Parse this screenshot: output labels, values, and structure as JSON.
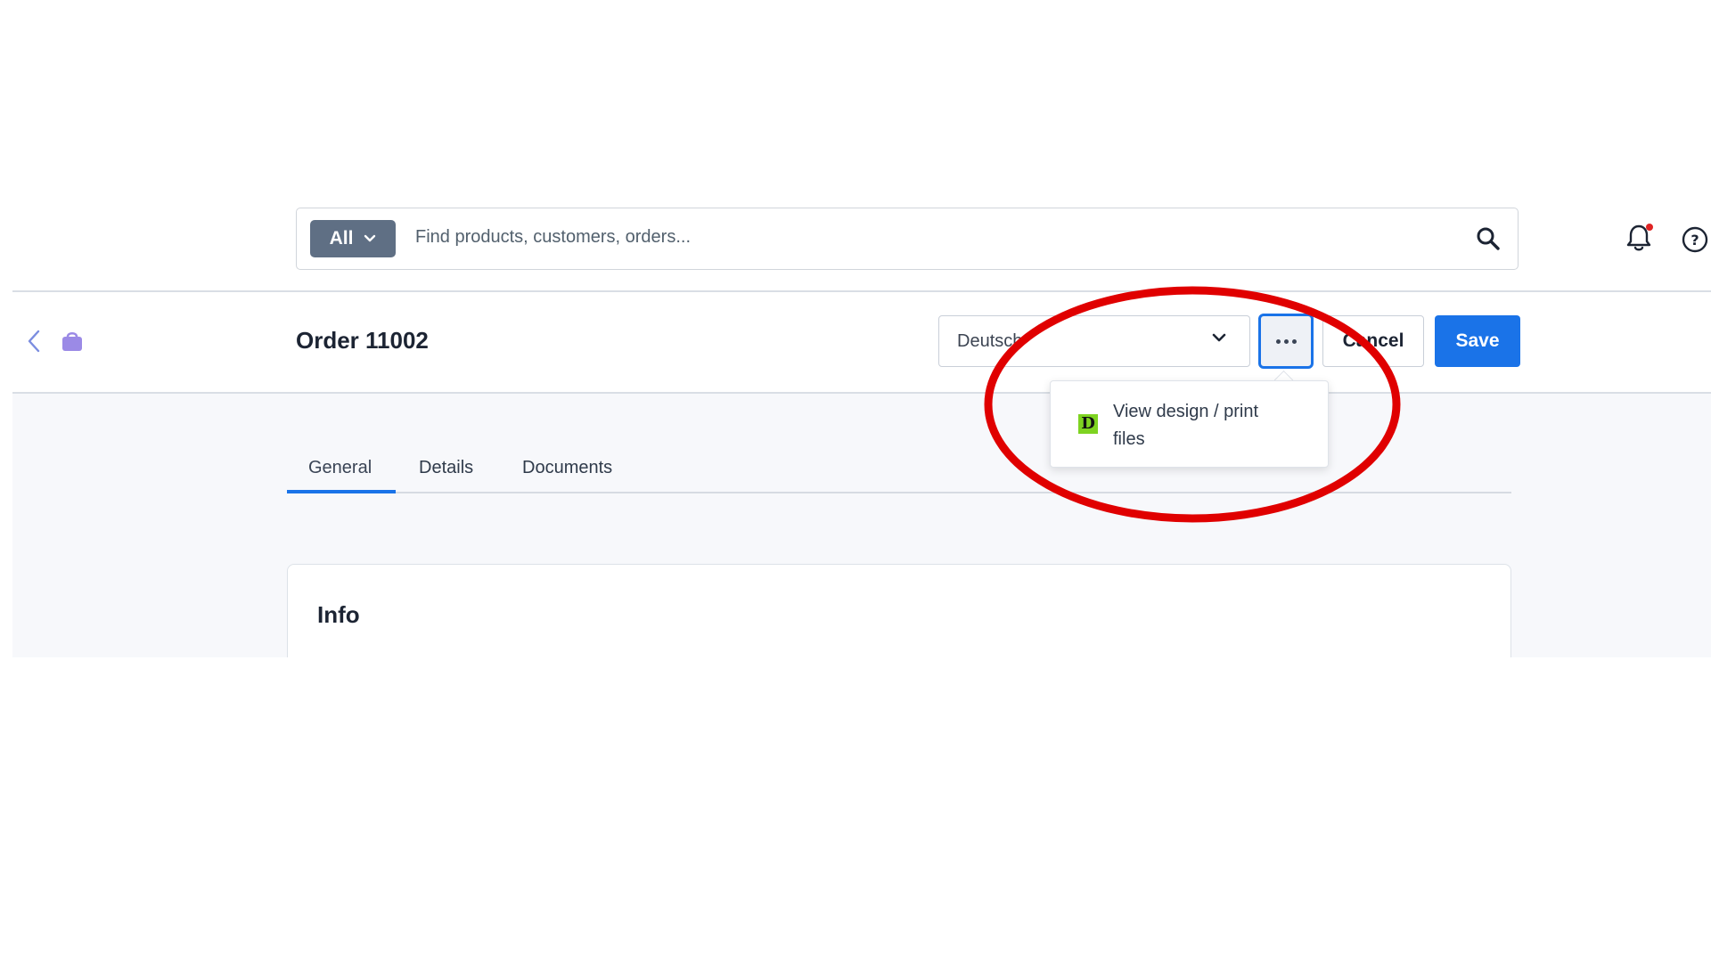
{
  "search": {
    "scope_label": "All",
    "placeholder": "Find products, customers, orders..."
  },
  "header": {
    "title": "Order 11002",
    "language_value": "Deutsch",
    "cancel_label": "Cancel",
    "save_label": "Save"
  },
  "more_menu": {
    "items": [
      {
        "label": "View design / print files",
        "logo_letter": "D"
      }
    ]
  },
  "tabs": [
    {
      "label": "General",
      "active": true
    },
    {
      "label": "Details",
      "active": false
    },
    {
      "label": "Documents",
      "active": false
    }
  ],
  "info_card": {
    "title": "Info"
  },
  "icons": {
    "back": "chevron-left-icon",
    "module": "shopping-bag-icon",
    "search": "search-icon",
    "notifications": "bell-icon",
    "help": "help-circle-icon",
    "more": "ellipsis-icon"
  },
  "colors": {
    "primary": "#1a73e8",
    "scope_button": "#5f6f84",
    "annotation": "#e00000",
    "design_logo": "#7ed321",
    "notification_dot": "#e02424"
  }
}
